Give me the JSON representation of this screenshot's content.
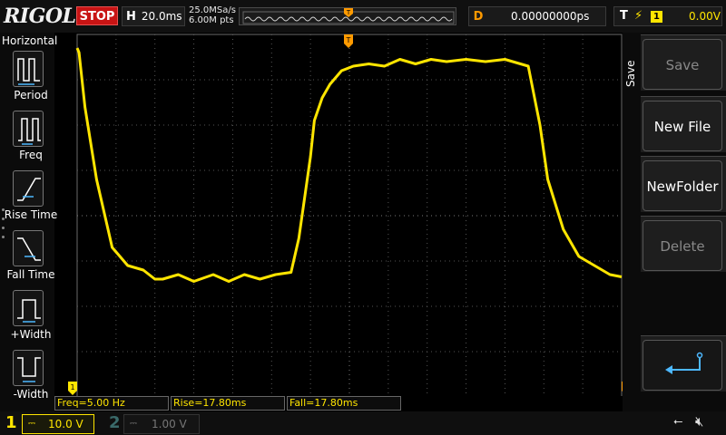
{
  "brand": "RIGOL",
  "status": "STOP",
  "horizontal": {
    "label": "H",
    "scale": "20.0ms"
  },
  "sample_rate": "25.0MSa/s",
  "memory_depth": "6.00M pts",
  "delay": {
    "label": "D",
    "value": "0.00000000ps"
  },
  "trigger": {
    "label": "T",
    "source": "1",
    "level": "0.00V"
  },
  "left_menu": {
    "title": "Horizontal",
    "items": [
      {
        "label": "Period",
        "icon": "period-icon"
      },
      {
        "label": "Freq",
        "icon": "frequency-icon"
      },
      {
        "label": "Rise Time",
        "icon": "rise-time-icon"
      },
      {
        "label": "Fall Time",
        "icon": "fall-time-icon"
      },
      {
        "label": "+Width",
        "icon": "positive-width-icon"
      },
      {
        "label": "-Width",
        "icon": "negative-width-icon"
      }
    ]
  },
  "right_menu": {
    "title": "Save",
    "buttons": [
      {
        "label": "Save",
        "enabled": false
      },
      {
        "label": "New File",
        "enabled": true
      },
      {
        "label": "NewFolder",
        "enabled": true
      },
      {
        "label": "Delete",
        "enabled": false
      }
    ],
    "back_icon": "return-arrow-icon"
  },
  "measurements": [
    {
      "text": "Freq=5.00 Hz"
    },
    {
      "text": "Rise=17.80ms"
    },
    {
      "text": "Fall=17.80ms"
    }
  ],
  "channels": [
    {
      "number": "1",
      "coupling": "DC",
      "scale": "10.0 V",
      "color": "#ffe500",
      "active": true
    },
    {
      "number": "2",
      "coupling": "DC",
      "scale": "1.00 V",
      "color": "#3a6a6a",
      "active": false
    }
  ],
  "colors": {
    "trace": "#ffe500",
    "trigger_marker": "#ff9a00",
    "stop": "#c81414"
  },
  "chart_data": {
    "type": "line",
    "x_unit": "div",
    "y_unit": "div",
    "xlim": [
      0,
      14
    ],
    "ylim": [
      -4,
      4
    ],
    "series": [
      {
        "name": "CH1",
        "x": [
          0.0,
          0.05,
          0.2,
          0.5,
          0.9,
          1.3,
          1.7,
          2.0,
          2.2,
          2.6,
          3.0,
          3.5,
          3.9,
          4.3,
          4.7,
          5.1,
          5.5,
          5.7,
          6.0,
          6.1,
          6.3,
          6.5,
          6.8,
          7.1,
          7.5,
          7.9,
          8.3,
          8.7,
          9.1,
          9.5,
          10.0,
          10.5,
          11.0,
          11.6,
          11.9,
          12.1,
          12.5,
          12.9,
          13.3,
          13.7,
          14.0
        ],
        "y": [
          3.7,
          3.6,
          2.4,
          0.8,
          -0.7,
          -1.1,
          -1.2,
          -1.4,
          -1.4,
          -1.3,
          -1.45,
          -1.3,
          -1.45,
          -1.3,
          -1.4,
          -1.3,
          -1.25,
          -0.5,
          1.3,
          2.1,
          2.6,
          2.9,
          3.2,
          3.3,
          3.35,
          3.3,
          3.45,
          3.35,
          3.45,
          3.4,
          3.45,
          3.4,
          3.45,
          3.3,
          2.0,
          0.8,
          -0.3,
          -0.9,
          -1.1,
          -1.3,
          -1.35
        ]
      }
    ],
    "grid": true
  }
}
